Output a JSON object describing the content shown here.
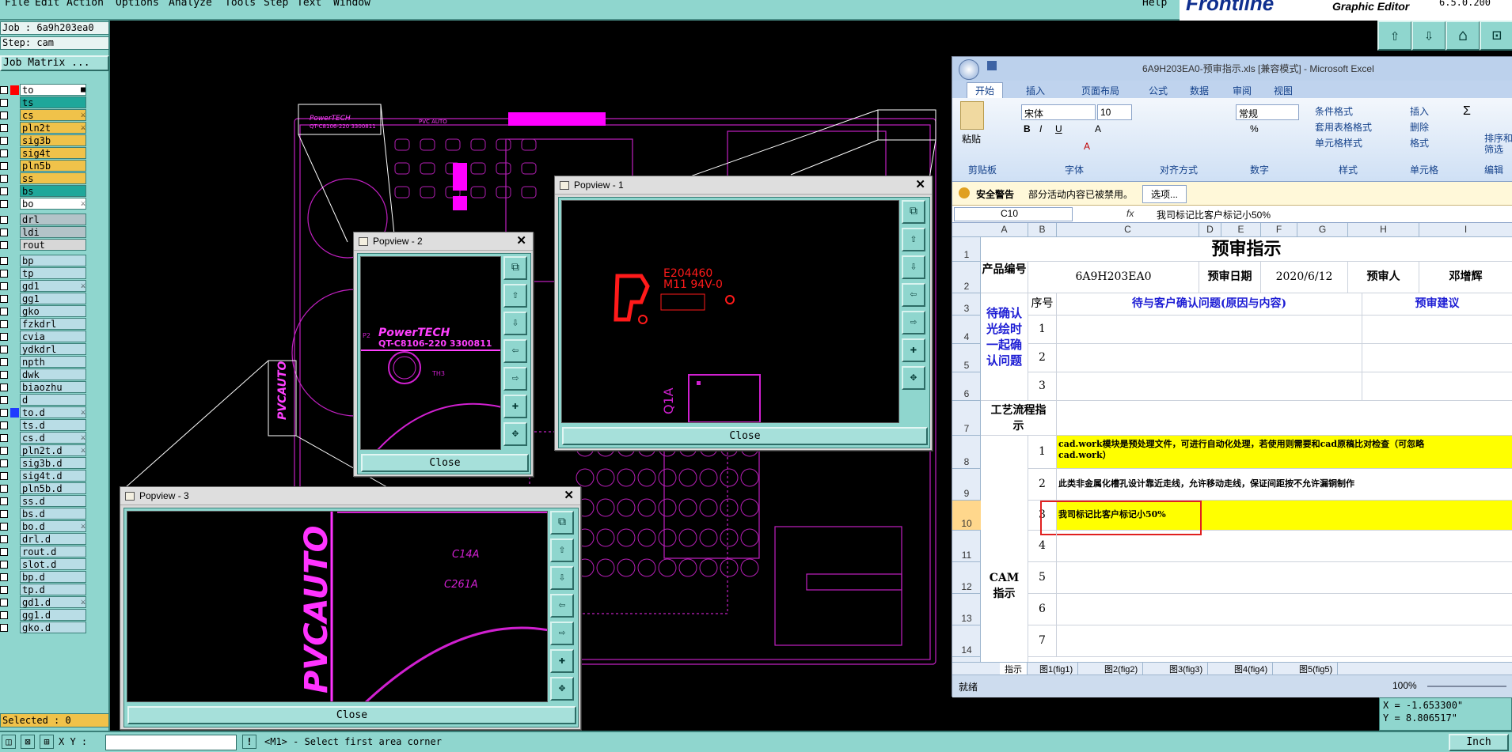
{
  "menu": {
    "items": [
      "File",
      "Edit",
      "Action",
      "Options",
      "Analyze",
      "Tools",
      "Step",
      "Text",
      "Window"
    ],
    "help": "Help"
  },
  "brand": {
    "logo": "Frontline",
    "subtitle": "Graphic Editor",
    "version": "6.5.0.200"
  },
  "job": {
    "label": "Job : 6a9h203ea0",
    "step": "Step: cam",
    "matrix_button": "Job Matrix ..."
  },
  "layers": [
    {
      "name": "to",
      "color": "#ffffff",
      "flag": "■",
      "swatch": "#ff0000"
    },
    {
      "name": "ts",
      "color": "#1fa79a",
      "flag": ""
    },
    {
      "name": "cs",
      "color": "#f0c24a",
      "flag": "⚔"
    },
    {
      "name": "pln2t",
      "color": "#f0c24a",
      "flag": "⚔"
    },
    {
      "name": "sig3b",
      "color": "#f0c24a",
      "flag": ""
    },
    {
      "name": "sig4t",
      "color": "#f0c24a",
      "flag": ""
    },
    {
      "name": "pln5b",
      "color": "#f0c24a",
      "flag": ""
    },
    {
      "name": "ss",
      "color": "#f0c24a",
      "flag": ""
    },
    {
      "name": "bs",
      "color": "#1fa79a",
      "flag": ""
    },
    {
      "name": "bo",
      "color": "#ffffff",
      "flag": "⚔"
    },
    {
      "name": "drl",
      "color": "#b3c3c8",
      "flag": ""
    },
    {
      "name": "ldi",
      "color": "#b3c3c8",
      "flag": ""
    },
    {
      "name": "rout",
      "color": "#d7d7d7",
      "flag": ""
    },
    {
      "name": "bp",
      "color": "#b9dde6",
      "flag": ""
    },
    {
      "name": "tp",
      "color": "#b9dde6",
      "flag": ""
    },
    {
      "name": "gd1",
      "color": "#b9dde6",
      "flag": "⚔"
    },
    {
      "name": "gg1",
      "color": "#b9dde6",
      "flag": ""
    },
    {
      "name": "gko",
      "color": "#b9dde6",
      "flag": ""
    },
    {
      "name": "fzkdrl",
      "color": "#b9dde6",
      "flag": ""
    },
    {
      "name": "cvia",
      "color": "#b9dde6",
      "flag": ""
    },
    {
      "name": "ydkdrl",
      "color": "#b9dde6",
      "flag": ""
    },
    {
      "name": "npth",
      "color": "#b9dde6",
      "flag": ""
    },
    {
      "name": "dwk",
      "color": "#b9dde6",
      "flag": ""
    },
    {
      "name": "biaozhu",
      "color": "#b9dde6",
      "flag": ""
    },
    {
      "name": "d",
      "color": "#b9dde6",
      "flag": ""
    },
    {
      "name": "to.d",
      "color": "#b9dde6",
      "flag": "⚔",
      "swatch": "#1f3bff"
    },
    {
      "name": "ts.d",
      "color": "#b9dde6",
      "flag": ""
    },
    {
      "name": "cs.d",
      "color": "#b9dde6",
      "flag": "⚔"
    },
    {
      "name": "pln2t.d",
      "color": "#b9dde6",
      "flag": "⚔"
    },
    {
      "name": "sig3b.d",
      "color": "#b9dde6",
      "flag": ""
    },
    {
      "name": "sig4t.d",
      "color": "#b9dde6",
      "flag": ""
    },
    {
      "name": "pln5b.d",
      "color": "#b9dde6",
      "flag": ""
    },
    {
      "name": "ss.d",
      "color": "#b9dde6",
      "flag": ""
    },
    {
      "name": "bs.d",
      "color": "#b9dde6",
      "flag": ""
    },
    {
      "name": "bo.d",
      "color": "#b9dde6",
      "flag": "⚔"
    },
    {
      "name": "drl.d",
      "color": "#b9dde6",
      "flag": ""
    },
    {
      "name": "rout.d",
      "color": "#b9dde6",
      "flag": ""
    },
    {
      "name": "slot.d",
      "color": "#b9dde6",
      "flag": ""
    },
    {
      "name": "bp.d",
      "color": "#b9dde6",
      "flag": ""
    },
    {
      "name": "tp.d",
      "color": "#b9dde6",
      "flag": ""
    },
    {
      "name": "gd1.d",
      "color": "#b9dde6",
      "flag": "⚔"
    },
    {
      "name": "gg1.d",
      "color": "#b9dde6",
      "flag": ""
    },
    {
      "name": "gko.d",
      "color": "#b9dde6",
      "flag": ""
    }
  ],
  "selected": "Selected : 0",
  "popviews": {
    "p1": {
      "title": "Popview - 1",
      "close": "Close",
      "text1": "E204460",
      "text2": "M11 94V-0",
      "text3": "Q1A"
    },
    "p2": {
      "title": "Popview - 2",
      "close": "Close",
      "text1": "PowerTECH",
      "text2": "QT-C8106-220  3300811",
      "text3": "P2",
      "text4": "TH3"
    },
    "p3": {
      "title": "Popview - 3",
      "close": "Close",
      "text1": "PVCAUTO",
      "text2": "C14A",
      "text3": "C261A"
    }
  },
  "board": {
    "text1": "PowerTECH",
    "text2": "QT-C8106-220  3300811",
    "text3": "PVC AUTO",
    "text4": "PVCAUTO"
  },
  "excel": {
    "title": "6A9H203EA0-预审指示.xls [兼容模式] - Microsoft Excel",
    "tabs": [
      "开始",
      "插入",
      "页面布局",
      "公式",
      "数据",
      "审阅",
      "视图"
    ],
    "groups": [
      "剪贴板",
      "字体",
      "对齐方式",
      "数字",
      "样式",
      "单元格",
      "编辑"
    ],
    "paste": "粘贴",
    "font_name": "宋体",
    "font_size": "10",
    "number_format": "常规",
    "styles": [
      "条件格式",
      "套用表格格式",
      "单元格样式"
    ],
    "cells_grp": [
      "插入",
      "删除",
      "格式"
    ],
    "edit_grp": [
      "排序和",
      "筛选"
    ],
    "security_label": "安全警告",
    "security_msg": "部分活动内容已被禁用。",
    "options_btn": "选项...",
    "namebox": "C10",
    "fx": "fx",
    "formula": "我司标记比客户标记小50%",
    "cols": [
      "A",
      "B",
      "C",
      "D",
      "E",
      "F",
      "G",
      "H",
      "I"
    ],
    "rows": [
      "1",
      "2",
      "3",
      "4",
      "5",
      "6",
      "7",
      "8",
      "9",
      "10",
      "11",
      "12",
      "13",
      "14"
    ],
    "sheet_title": "预审指示",
    "product_no_label": "产品编号",
    "product_no": "6A9H203EA0",
    "review_date_label": "预审日期",
    "review_date": "2020/6/12",
    "reviewer_label": "预审人",
    "reviewer": "邓增辉",
    "seq_label": "序号",
    "issue_label": "待与客户确认问题(原因与内容)",
    "advice_label": "预审建议",
    "confirm_label": "待确认光绘时一起确认问题",
    "process_label": "工艺流程指示",
    "cam_label": "CAM指示",
    "nums": [
      "1",
      "2",
      "3",
      "1",
      "2",
      "3",
      "4",
      "5",
      "6",
      "7"
    ],
    "cam_item1": "cad.work模块是预处理文件，可进行自动化处理，若使用则需要和cad原稿比对检查（可忽略",
    "cam_item1b": "cad.work）",
    "cam_item2": "此类非金属化槽孔设计靠近走线，允许移动走线，保证间距按不允许漏铜制作",
    "cam_item3": "我司标记比客户标记小50%",
    "sheet_tabs": [
      "指示",
      "图1(fig1)",
      "图2(fig2)",
      "图3(fig3)",
      "图4(fig4)",
      "图5(fig5)"
    ],
    "status_ready": "就绪",
    "zoom": "100%"
  },
  "coords": {
    "x": "X = -1.653300\"",
    "y": "Y = 8.806517\""
  },
  "status": {
    "xy_label": "X Y :",
    "xy_value": "",
    "message": "<M1> - Select first area corner",
    "units": "Inch"
  }
}
